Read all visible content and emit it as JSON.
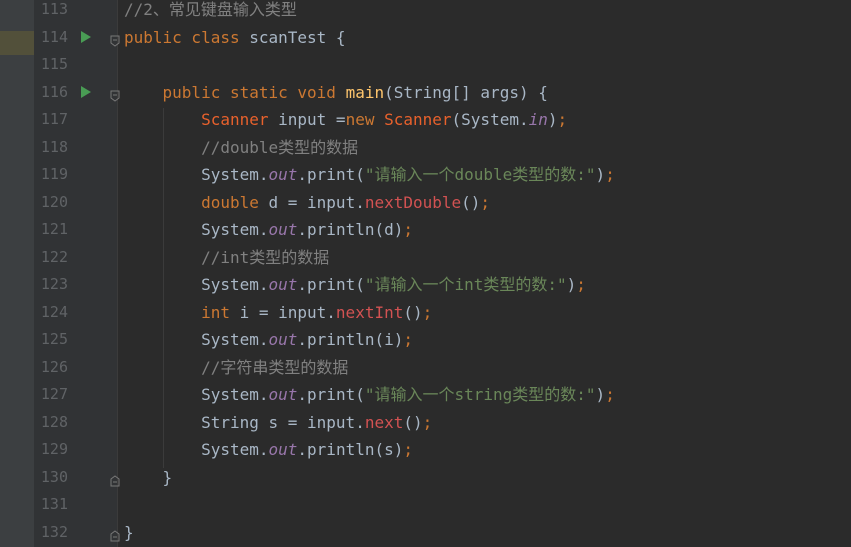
{
  "colors": {
    "background": "#2b2b2b",
    "gutter": "#313335",
    "line_number": "#606366",
    "keyword": "#cc7832",
    "string": "#6a8759",
    "comment": "#808080",
    "static_field": "#9876aa",
    "method_call": "#d25252",
    "method_decl": "#ffc66d",
    "run_icon": "#499c54"
  },
  "icons": {
    "run": "run-icon",
    "fold": "fold-icon"
  },
  "lines": [
    {
      "number": "113",
      "tokens": [
        {
          "t": "//2、常见键盘输入类型",
          "c": "cm"
        }
      ]
    },
    {
      "number": "114",
      "run": true,
      "fold": true,
      "tokens": [
        {
          "t": "public class ",
          "c": "kw"
        },
        {
          "t": "scanTest {",
          "c": "pl"
        }
      ]
    },
    {
      "number": "115",
      "tokens": []
    },
    {
      "number": "116",
      "run": true,
      "fold": true,
      "tokens": [
        {
          "t": "    ",
          "c": "pl"
        },
        {
          "t": "public static void ",
          "c": "kw"
        },
        {
          "t": "main",
          "c": "fn"
        },
        {
          "t": "(String[] args) {",
          "c": "pl"
        }
      ]
    },
    {
      "number": "117",
      "tokens": [
        {
          "t": "        ",
          "c": "pl"
        },
        {
          "t": "Scanner",
          "c": "ty"
        },
        {
          "t": " input =",
          "c": "pl"
        },
        {
          "t": "new ",
          "c": "kw"
        },
        {
          "t": "Scanner",
          "c": "ty"
        },
        {
          "t": "(System.",
          "c": "pl"
        },
        {
          "t": "in",
          "c": "sf"
        },
        {
          "t": ")",
          "c": "pl"
        },
        {
          "t": ";",
          "c": "kw"
        }
      ]
    },
    {
      "number": "118",
      "tokens": [
        {
          "t": "        ",
          "c": "pl"
        },
        {
          "t": "//double类型的数据",
          "c": "cm"
        }
      ]
    },
    {
      "number": "119",
      "tokens": [
        {
          "t": "        System.",
          "c": "pl"
        },
        {
          "t": "out",
          "c": "sf"
        },
        {
          "t": ".print(",
          "c": "pl"
        },
        {
          "t": "\"请输入一个double类型的数:\"",
          "c": "st"
        },
        {
          "t": ")",
          "c": "pl"
        },
        {
          "t": ";",
          "c": "kw"
        }
      ]
    },
    {
      "number": "120",
      "tokens": [
        {
          "t": "        ",
          "c": "pl"
        },
        {
          "t": "double ",
          "c": "kw"
        },
        {
          "t": "d = input.",
          "c": "pl"
        },
        {
          "t": "nextDouble",
          "c": "mc"
        },
        {
          "t": "()",
          "c": "pl"
        },
        {
          "t": ";",
          "c": "kw"
        }
      ]
    },
    {
      "number": "121",
      "tokens": [
        {
          "t": "        System.",
          "c": "pl"
        },
        {
          "t": "out",
          "c": "sf"
        },
        {
          "t": ".println(d)",
          "c": "pl"
        },
        {
          "t": ";",
          "c": "kw"
        }
      ]
    },
    {
      "number": "122",
      "tokens": [
        {
          "t": "        ",
          "c": "pl"
        },
        {
          "t": "//int类型的数据",
          "c": "cm"
        }
      ]
    },
    {
      "number": "123",
      "tokens": [
        {
          "t": "        System.",
          "c": "pl"
        },
        {
          "t": "out",
          "c": "sf"
        },
        {
          "t": ".print(",
          "c": "pl"
        },
        {
          "t": "\"请输入一个int类型的数:\"",
          "c": "st"
        },
        {
          "t": ")",
          "c": "pl"
        },
        {
          "t": ";",
          "c": "kw"
        }
      ]
    },
    {
      "number": "124",
      "tokens": [
        {
          "t": "        ",
          "c": "pl"
        },
        {
          "t": "int ",
          "c": "kw"
        },
        {
          "t": "i = input.",
          "c": "pl"
        },
        {
          "t": "nextInt",
          "c": "mc"
        },
        {
          "t": "()",
          "c": "pl"
        },
        {
          "t": ";",
          "c": "kw"
        }
      ]
    },
    {
      "number": "125",
      "tokens": [
        {
          "t": "        System.",
          "c": "pl"
        },
        {
          "t": "out",
          "c": "sf"
        },
        {
          "t": ".println(i)",
          "c": "pl"
        },
        {
          "t": ";",
          "c": "kw"
        }
      ]
    },
    {
      "number": "126",
      "tokens": [
        {
          "t": "        ",
          "c": "pl"
        },
        {
          "t": "//字符串类型的数据",
          "c": "cm"
        }
      ]
    },
    {
      "number": "127",
      "tokens": [
        {
          "t": "        System.",
          "c": "pl"
        },
        {
          "t": "out",
          "c": "sf"
        },
        {
          "t": ".print(",
          "c": "pl"
        },
        {
          "t": "\"请输入一个string类型的数:\"",
          "c": "st"
        },
        {
          "t": ")",
          "c": "pl"
        },
        {
          "t": ";",
          "c": "kw"
        }
      ]
    },
    {
      "number": "128",
      "tokens": [
        {
          "t": "        String s = input.",
          "c": "pl"
        },
        {
          "t": "next",
          "c": "mc"
        },
        {
          "t": "()",
          "c": "pl"
        },
        {
          "t": ";",
          "c": "kw"
        }
      ]
    },
    {
      "number": "129",
      "tokens": [
        {
          "t": "        System.",
          "c": "pl"
        },
        {
          "t": "out",
          "c": "sf"
        },
        {
          "t": ".println(s)",
          "c": "pl"
        },
        {
          "t": ";",
          "c": "kw"
        }
      ]
    },
    {
      "number": "130",
      "fold_end": true,
      "tokens": [
        {
          "t": "    }",
          "c": "pl"
        }
      ]
    },
    {
      "number": "131",
      "tokens": []
    },
    {
      "number": "132",
      "fold_end": true,
      "tokens": [
        {
          "t": "}",
          "c": "pl"
        }
      ]
    }
  ]
}
